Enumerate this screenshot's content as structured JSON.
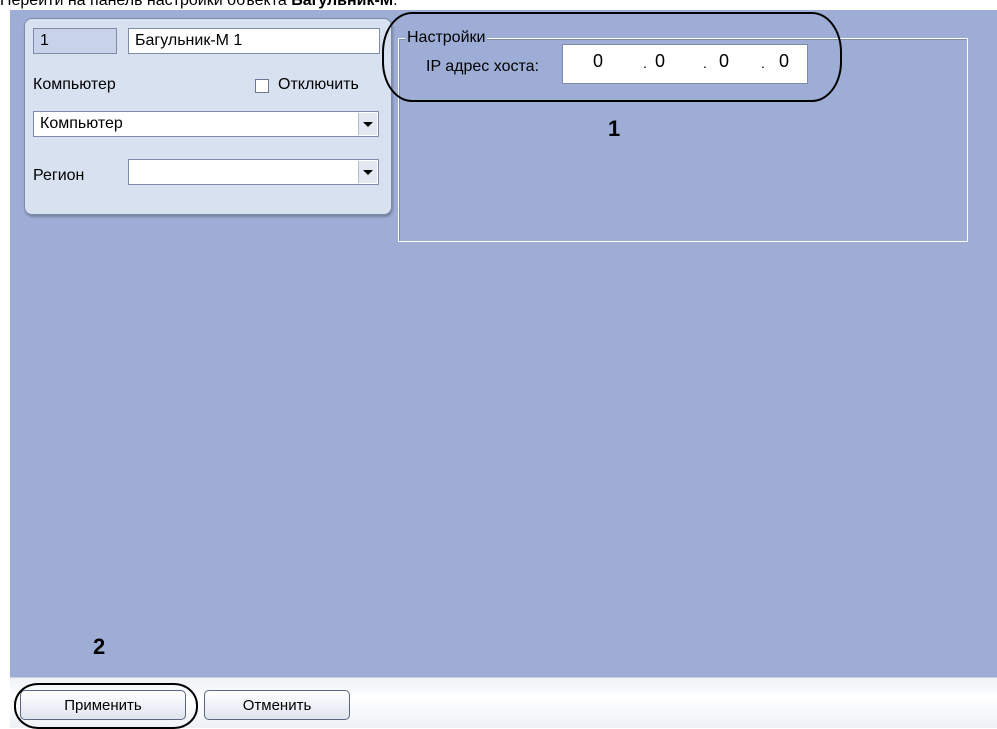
{
  "doc": {
    "caption_prefix": "Перейти на панель настройки объекта ",
    "caption_bold": "Багульник-М",
    "caption_suffix": "."
  },
  "object": {
    "id": "1",
    "name": "Багульник-М 1",
    "computer_label": "Компьютер",
    "disable_label": "Отключить",
    "disable_checked": false,
    "computer_value": "Компьютер",
    "region_label": "Регион",
    "region_value": ""
  },
  "settings": {
    "legend": "Настройки",
    "ip_label": "IP адрес хоста:",
    "ip_octets": [
      "0",
      "0",
      "0",
      "0"
    ],
    "ip_sep": "."
  },
  "callouts": {
    "one": "1",
    "two": "2"
  },
  "buttons": {
    "apply": "Применить",
    "cancel": "Отменить"
  },
  "colors": {
    "panel_bg": "#9dadd5",
    "group_bg": "#d8e1f0"
  }
}
